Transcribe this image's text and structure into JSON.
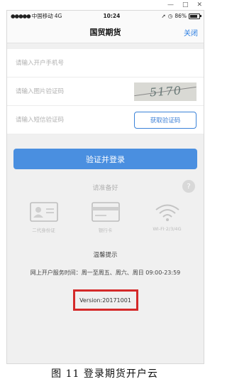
{
  "window_controls": {
    "minimize": "—",
    "maximize": "□",
    "close": "✕"
  },
  "status_bar": {
    "carrier": "中国移动",
    "network": "4G",
    "time": "10:24",
    "battery_percent": "86%",
    "battery_level": 0.86
  },
  "nav": {
    "title": "国贸期货",
    "close_label": "关闭"
  },
  "form": {
    "phone_placeholder": "请输入开户手机号",
    "captcha_placeholder": "请输入图片验证码",
    "captcha_text": "5170",
    "sms_placeholder": "请输入短信验证码",
    "sms_button": "获取验证码"
  },
  "login_button": "验证并登录",
  "prep": {
    "title": "请准备好",
    "help": "?"
  },
  "requirements": [
    {
      "icon": "id-card-icon",
      "label": "二代身份证"
    },
    {
      "icon": "bank-card-icon",
      "label": "银行卡"
    },
    {
      "icon": "wifi-icon",
      "label": "WI-FI·2/3/4G"
    }
  ],
  "hint": {
    "title": "温馨提示",
    "text": "网上开户服务时间：周一至周五、周六、周日 09:00-23:59"
  },
  "version": "Version:20171001",
  "caption": "图 11 登录期货开户云",
  "colors": {
    "accent": "#4a8fe0",
    "highlight": "#d42a2a"
  }
}
